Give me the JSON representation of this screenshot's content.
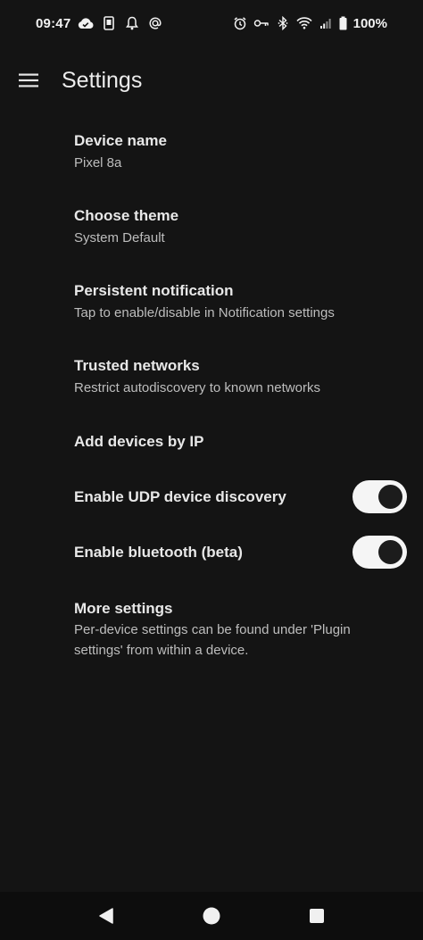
{
  "status_bar": {
    "time": "09:47",
    "battery_percent": "100%",
    "left_icons": [
      "cloud-check-icon",
      "phone-screen-icon",
      "bell-icon",
      "at-sign-icon"
    ],
    "right_icons": [
      "alarm-icon",
      "key-icon",
      "bluetooth-icon",
      "wifi-icon",
      "signal-icon",
      "battery-icon"
    ]
  },
  "app_bar": {
    "menu_icon": "hamburger-menu-icon",
    "title": "Settings"
  },
  "settings": {
    "device_name": {
      "title": "Device name",
      "summary": "Pixel 8a"
    },
    "choose_theme": {
      "title": "Choose theme",
      "summary": "System Default"
    },
    "persistent_notification": {
      "title": "Persistent notification",
      "summary": "Tap to enable/disable in Notification settings"
    },
    "trusted_networks": {
      "title": "Trusted networks",
      "summary": "Restrict autodiscovery to known networks"
    },
    "add_devices_by_ip": {
      "title": "Add devices by IP"
    },
    "enable_udp": {
      "title": "Enable UDP device discovery",
      "enabled": true
    },
    "enable_bluetooth": {
      "title": "Enable bluetooth (beta)",
      "enabled": true
    },
    "more_settings": {
      "title": "More settings",
      "summary": "Per-device settings can be found under 'Plugin settings' from within a device."
    }
  },
  "nav_bar": {
    "icons": [
      "back-icon",
      "home-icon",
      "recents-icon"
    ]
  },
  "colors": {
    "background": "#141414",
    "text_primary": "#e8e8e8",
    "text_secondary": "#bdbdbd",
    "toggle_track": "#f5f5f5",
    "toggle_knob": "#1c1c1c",
    "nav_bar": "#0d0d0d"
  }
}
